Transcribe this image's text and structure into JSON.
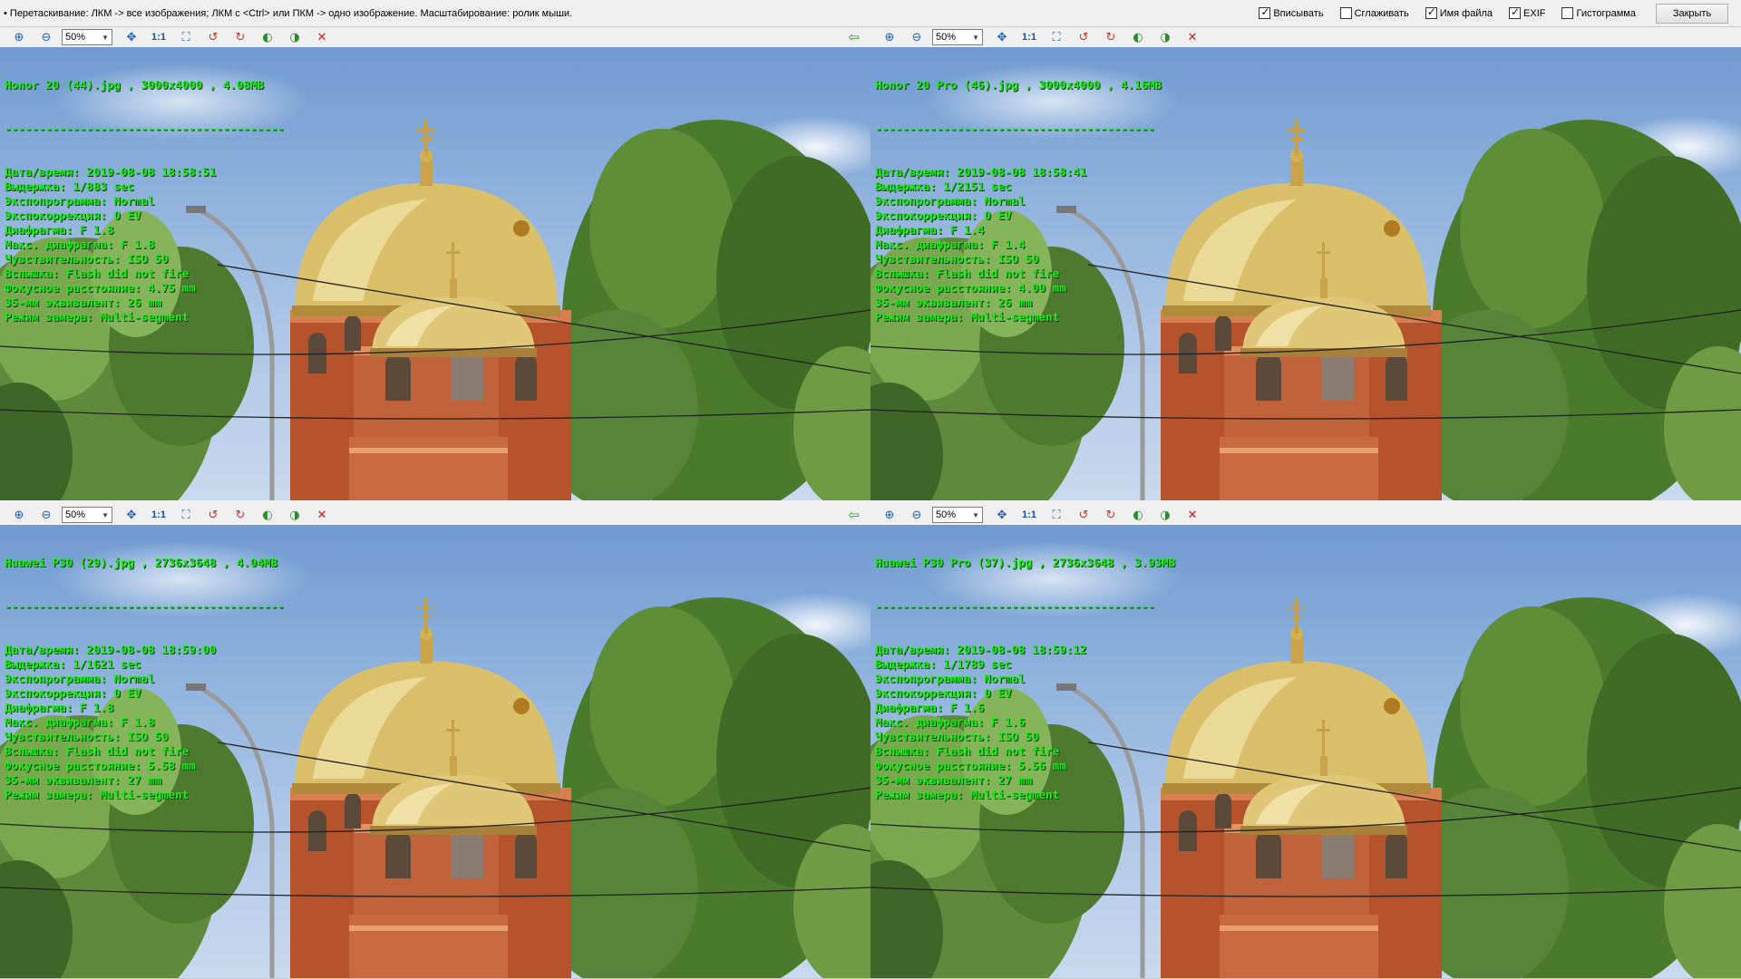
{
  "topbar": {
    "hint": "• Перетаскивание: ЛКМ -> все изображения; ЛКМ с <Ctrl> или ПКМ -> одно изображение. Масштабирование: ролик мыши.",
    "options": [
      {
        "label": "Вписывать",
        "checked": true
      },
      {
        "label": "Сглаживать",
        "checked": false
      },
      {
        "label": "Имя файла",
        "checked": true
      },
      {
        "label": "EXIF",
        "checked": true
      },
      {
        "label": "Гистограмма",
        "checked": false
      }
    ],
    "close_label": "Закрыть"
  },
  "toolbar": {
    "zoom_value": "50%",
    "one_to_one": "1:1",
    "icons": [
      "zoom-in-icon",
      "zoom-out-icon",
      "zoom-value",
      "fit-icon",
      "one-to-one",
      "fullscreen-icon",
      "rotate-left-icon",
      "rotate-right-icon",
      "prev-image-icon",
      "next-image-icon",
      "close-icon"
    ]
  },
  "panes": [
    {
      "title": "Honor 20 (44).jpg , 3000x4000 , 4.08MB",
      "sep": "-----------------------------------------",
      "rows": [
        "Дата/время: 2019-08-08 18:58:51",
        "Выдержка: 1/883 sec",
        "Экспопрограмма: Normal",
        "Экспокоррекция: 0 EV",
        "Диафрагма: F 1.8",
        "Макс. диафрагма: F 1.8",
        "Чувствительность: ISO 50",
        "Вспышка: Flash did not fire",
        "Фокусное расстояние: 4.75 mm",
        "35-мм эквивалент: 26 mm",
        "Режим замера: Multi-segment"
      ],
      "has_back_arrow": true
    },
    {
      "title": "Honor 20 Pro (46).jpg , 3000x4000 , 4.16MB",
      "sep": "-----------------------------------------",
      "rows": [
        "Дата/время: 2019-08-08 18:58:41",
        "Выдержка: 1/2151 sec",
        "Экспопрограмма: Normal",
        "Экспокоррекция: 0 EV",
        "Диафрагма: F 1.4",
        "Макс. диафрагма: F 1.4",
        "Чувствительность: ISO 50",
        "Вспышка: Flash did not fire",
        "Фокусное расстояние: 4.00 mm",
        "35-мм эквивалент: 26 mm",
        "Режим замера: Multi-segment"
      ],
      "has_back_arrow": false
    },
    {
      "title": "Huawei P30 (29).jpg , 2736x3648 , 4.04MB",
      "sep": "-----------------------------------------",
      "rows": [
        "Дата/время: 2019-08-08 18:59:00",
        "Выдержка: 1/1621 sec",
        "Экспопрограмма: Normal",
        "Экспокоррекция: 0 EV",
        "Диафрагма: F 1.8",
        "Макс. диафрагма: F 1.8",
        "Чувствительность: ISO 50",
        "Вспышка: Flash did not fire",
        "Фокусное расстояние: 5.58 mm",
        "35-мм эквивалент: 27 mm",
        "Режим замера: Multi-segment"
      ],
      "has_back_arrow": true
    },
    {
      "title": "Huawei P30 Pro (37).jpg , 2736x3648 , 3.93MB",
      "sep": "-----------------------------------------",
      "rows": [
        "Дата/время: 2019-08-08 18:59:12",
        "Выдержка: 1/1789 sec",
        "Экспопрограмма: Normal",
        "Экспокоррекция: 0 EV",
        "Диафрагма: F 1.6",
        "Макс. диафрагма: F 1.6",
        "Чувствительность: ISO 50",
        "Вспышка: Flash did not fire",
        "Фокусное расстояние: 5.56 mm",
        "35-мм эквивалент: 27 mm",
        "Режим замера: Multi-segment"
      ],
      "has_back_arrow": false
    }
  ]
}
